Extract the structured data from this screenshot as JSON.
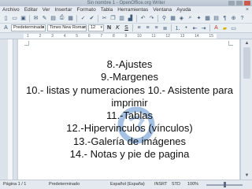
{
  "window": {
    "title": "Sin nombre 1 - OpenOffice.org Writer"
  },
  "menu": {
    "items": [
      "Archivo",
      "Editar",
      "Ver",
      "Insertar",
      "Formato",
      "Tabla",
      "Herramientas",
      "Ventana",
      "Ayuda"
    ],
    "close_label": "×"
  },
  "format_bar": {
    "paragraph_style": "Predeterminado",
    "font_name": "Times New Roman",
    "font_size": "12"
  },
  "ruler": {
    "marks": [
      "1",
      "2",
      "3",
      "4",
      "5",
      "6",
      "7",
      "8",
      "9",
      "10",
      "11",
      "12",
      "13",
      "14",
      "15"
    ]
  },
  "document": {
    "lines": [
      "8.-Ajustes",
      "9.-Margenes",
      "10.- listas y numeraciones 10.- Asistente para",
      "imprimir",
      "11.-Tablas",
      "12.-Hipervinculos (vínculos)",
      "13.-Galería de imágenes",
      "14.- Notas y pie de pagina"
    ]
  },
  "status": {
    "page": "Página 1 / 1",
    "style": "Predeterminado",
    "language": "Español (España)",
    "insert_mode": "INSRT",
    "selection_mode": "STD",
    "zoom": "100%",
    "zoom_fraction": 0.5
  },
  "colors": {
    "watermark": "#5b8fd0"
  }
}
